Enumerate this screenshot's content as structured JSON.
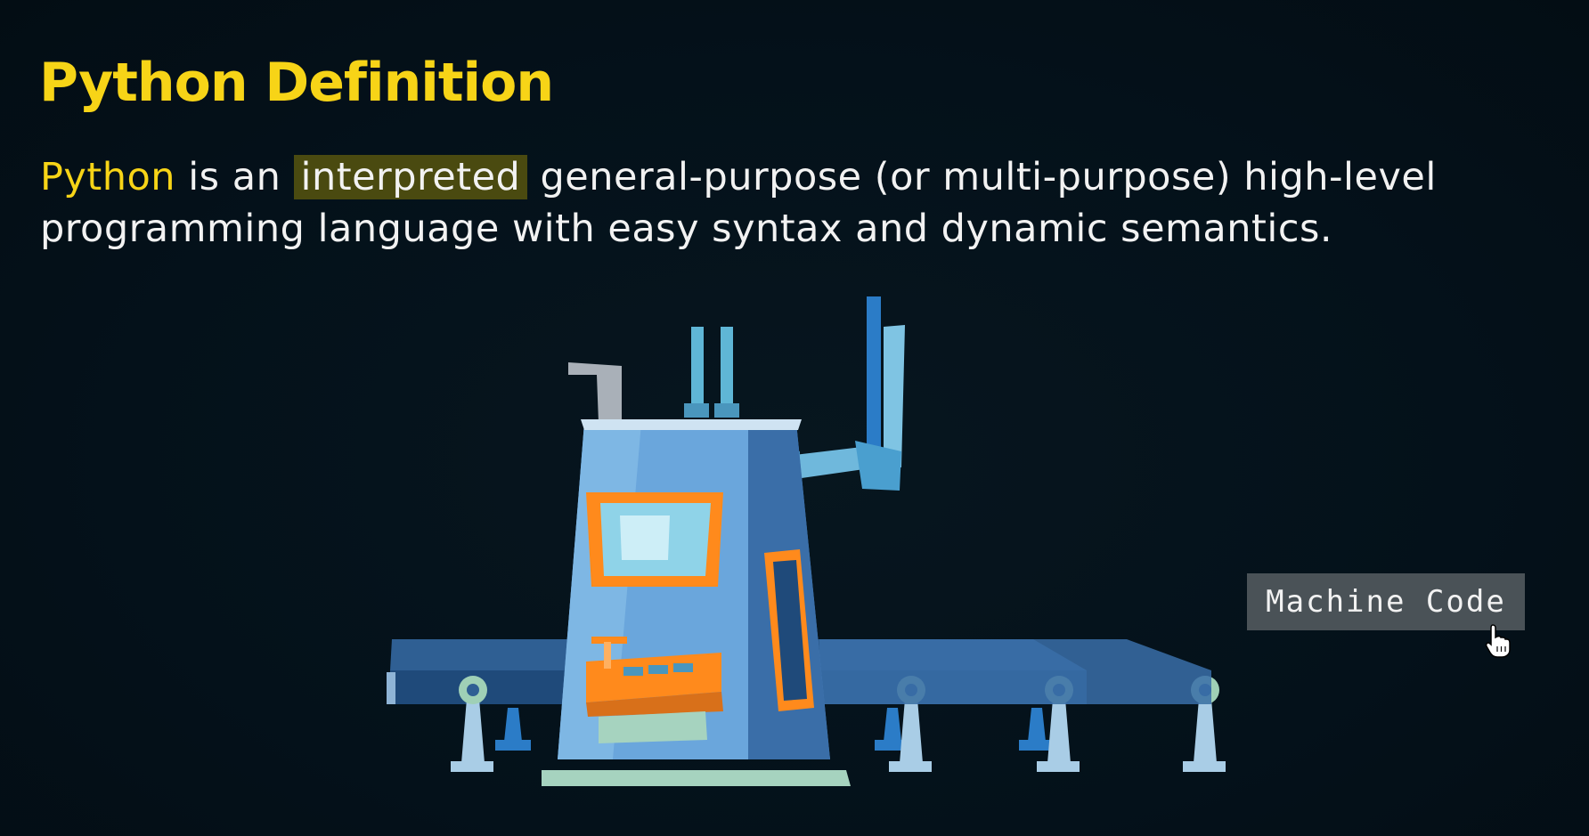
{
  "slide": {
    "title": "Python Definition",
    "definition": {
      "keyword": "Python",
      "text_1": " is an ",
      "highlight": "interpreted",
      "text_2": " general-purpose (or multi-purpose) high-level programming language with easy syntax and dynamic semantics."
    },
    "label": "Machine Code"
  },
  "icons": {
    "illustration": "factory-machine-illustration",
    "cursor": "hand-pointer-icon"
  },
  "colors": {
    "background": "#05121a",
    "title": "#f7d417",
    "keyword": "#f7d417",
    "highlight_bg": "#4a4a10",
    "text": "#f2f2f2",
    "label_bg": "#4a5257",
    "machine_body": "#4f86c6",
    "machine_accent": "#ff8a1c",
    "conveyor": "#2f5f93"
  }
}
